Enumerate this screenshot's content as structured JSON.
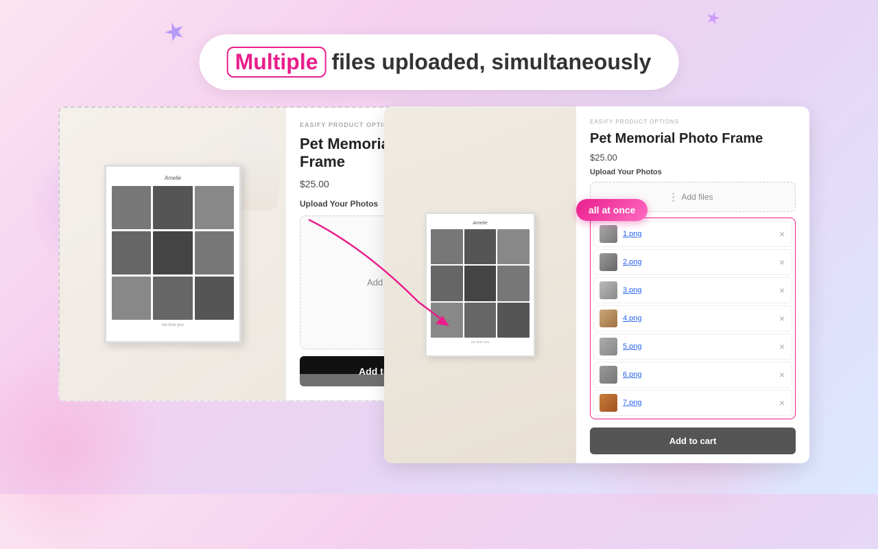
{
  "header": {
    "multiple_label": "Multiple",
    "rest_label": "files uploaded, simultaneously"
  },
  "left_product": {
    "easify_label": "EASIFY PRODUCT OPTIONS",
    "title": "Pet Memorial Photo Frame",
    "price": "$25.00",
    "upload_label": "Upload Your Photos",
    "add_files_label": "Add files",
    "add_to_cart_label": "Add to cart"
  },
  "right_product": {
    "easify_label": "EASIFY PRODUCT OPTIONS",
    "title": "Pet Memorial Photo Frame",
    "price": "$25.00",
    "upload_label": "Upload Your Photos",
    "add_files_label": "Add files",
    "add_to_cart_label": "Add to cart",
    "files": [
      {
        "name": "1.png",
        "thumb": "file-thumb-1"
      },
      {
        "name": "2.png",
        "thumb": "file-thumb-2"
      },
      {
        "name": "3.png",
        "thumb": "file-thumb-3"
      },
      {
        "name": "4.png",
        "thumb": "file-thumb-4"
      },
      {
        "name": "5.png",
        "thumb": "file-thumb-5"
      },
      {
        "name": "6.png",
        "thumb": "file-thumb-6"
      },
      {
        "name": "7.png",
        "thumb": "file-thumb-7"
      }
    ]
  },
  "tooltip": {
    "label": "all at once"
  },
  "decorations": {
    "star_symbol": "★"
  }
}
